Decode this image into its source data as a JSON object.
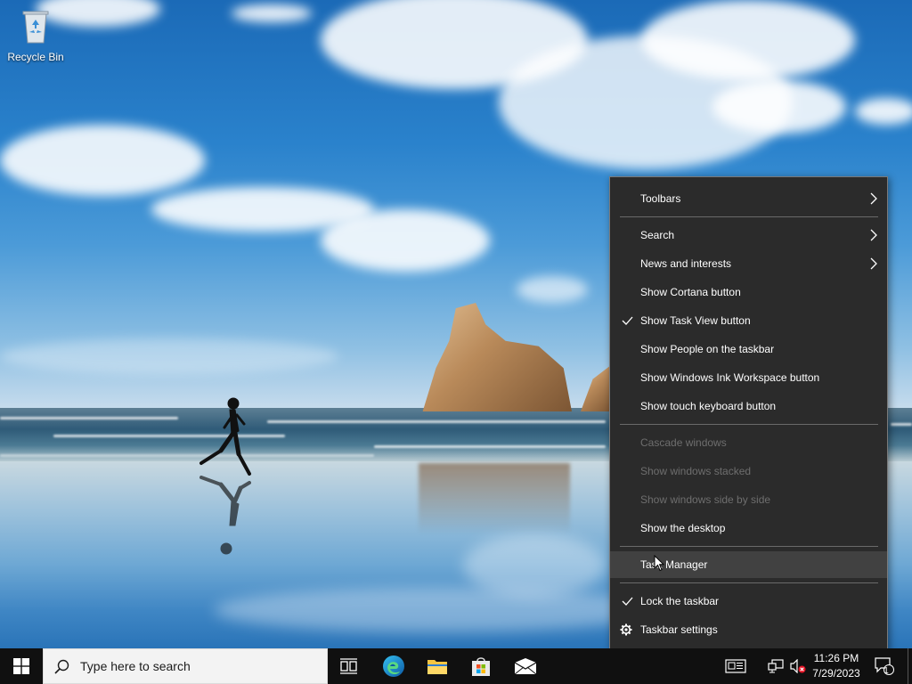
{
  "desktop": {
    "icons": [
      {
        "label": "Recycle Bin",
        "icon": "recycle-bin-icon"
      }
    ]
  },
  "context_menu": {
    "items": [
      {
        "label": "Toolbars",
        "submenu": true,
        "checked": false,
        "enabled": true
      },
      {
        "label": "Search",
        "submenu": true,
        "checked": false,
        "enabled": true
      },
      {
        "label": "News and interests",
        "submenu": true,
        "checked": false,
        "enabled": true
      },
      {
        "label": "Show Cortana button",
        "submenu": false,
        "checked": false,
        "enabled": true
      },
      {
        "label": "Show Task View button",
        "submenu": false,
        "checked": true,
        "enabled": true
      },
      {
        "label": "Show People on the taskbar",
        "submenu": false,
        "checked": false,
        "enabled": true
      },
      {
        "label": "Show Windows Ink Workspace button",
        "submenu": false,
        "checked": false,
        "enabled": true
      },
      {
        "label": "Show touch keyboard button",
        "submenu": false,
        "checked": false,
        "enabled": true
      },
      {
        "label": "Cascade windows",
        "submenu": false,
        "checked": false,
        "enabled": false
      },
      {
        "label": "Show windows stacked",
        "submenu": false,
        "checked": false,
        "enabled": false
      },
      {
        "label": "Show windows side by side",
        "submenu": false,
        "checked": false,
        "enabled": false
      },
      {
        "label": "Show the desktop",
        "submenu": false,
        "checked": false,
        "enabled": true
      },
      {
        "label": "Task Manager",
        "submenu": false,
        "checked": false,
        "enabled": true,
        "hovered": true
      },
      {
        "label": "Lock the taskbar",
        "submenu": false,
        "checked": true,
        "enabled": true
      },
      {
        "label": "Taskbar settings",
        "submenu": false,
        "checked": false,
        "enabled": true,
        "icon": "gear-icon"
      }
    ]
  },
  "taskbar": {
    "start_icon": "windows-logo-icon",
    "search_placeholder": "Type here to search",
    "pinned": [
      {
        "name": "Task View",
        "icon": "task-view-icon"
      },
      {
        "name": "Microsoft Edge",
        "icon": "edge-icon"
      },
      {
        "name": "File Explorer",
        "icon": "folder-icon"
      },
      {
        "name": "Microsoft Store",
        "icon": "store-icon"
      },
      {
        "name": "Mail",
        "icon": "mail-icon"
      }
    ],
    "tray_icons": [
      "news-icon",
      "network-icon",
      "volume-muted-icon"
    ],
    "clock": {
      "time": "11:26 PM",
      "date": "7/29/2023"
    },
    "notifications": {
      "count": "1",
      "icon": "action-center-icon"
    }
  },
  "colors": {
    "menu_bg": "#2b2b2b",
    "menu_hover": "#414141",
    "menu_disabled_text": "#6e6e6e",
    "taskbar_bg": "#101010"
  }
}
